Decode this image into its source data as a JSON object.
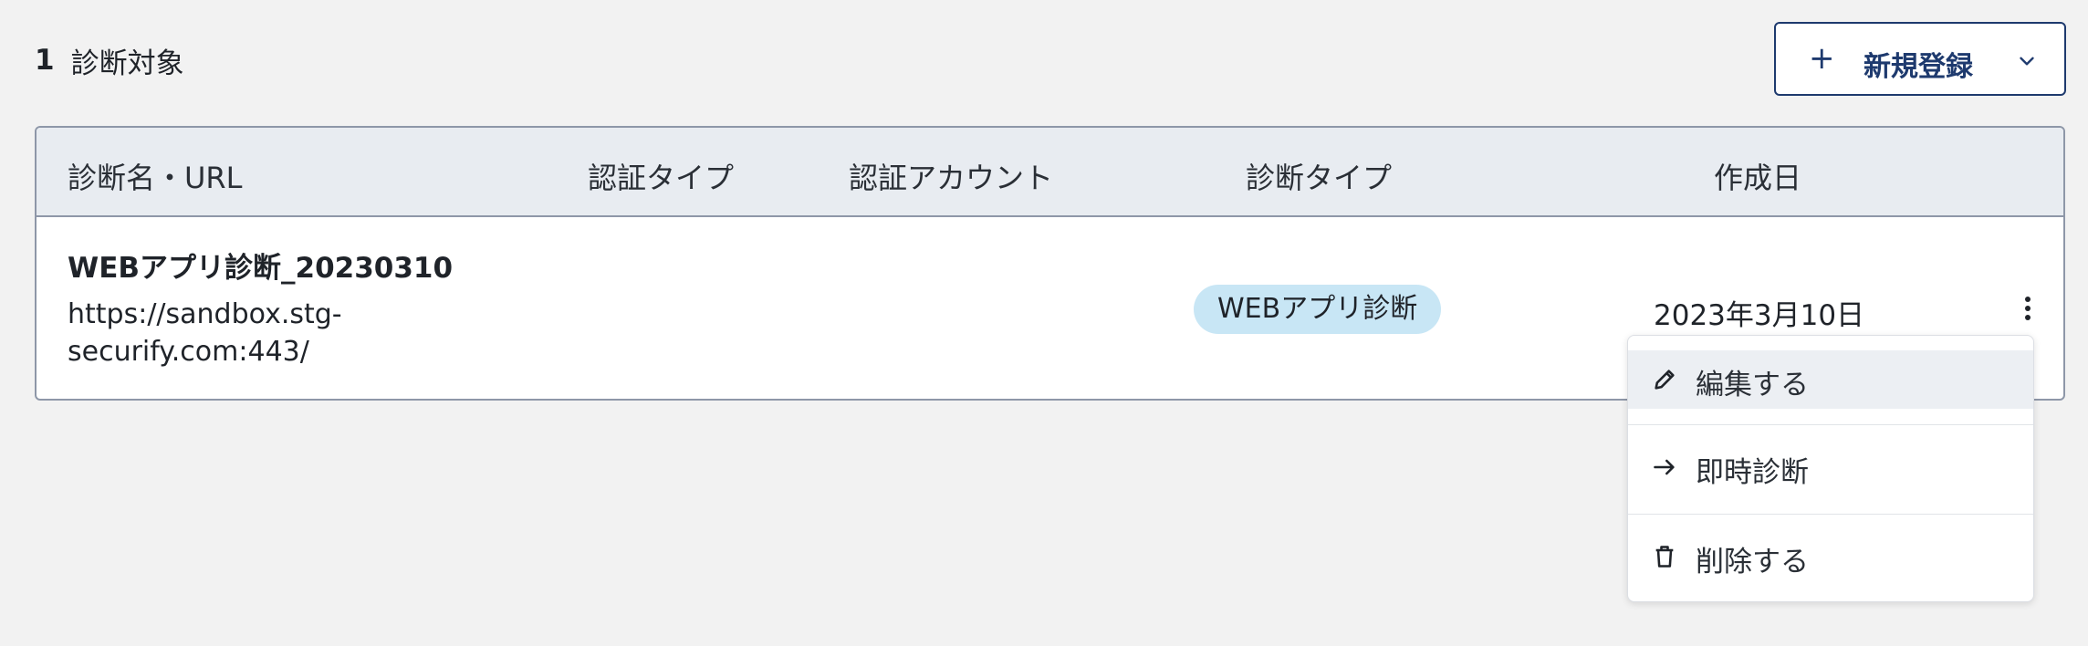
{
  "summary": {
    "count": "1",
    "label": "診断対象"
  },
  "new_button": {
    "plus": "+",
    "label": "新規登録",
    "chevron_icon": "chevron-down-icon"
  },
  "table": {
    "headers": [
      "診断名・URL",
      "認証タイプ",
      "認証アカウント",
      "診断タイプ",
      "作成日"
    ],
    "rows": [
      {
        "name": "WEBアプリ診断_20230310",
        "url": "https://sandbox.stg-securify.com:443/",
        "auth_type": "",
        "auth_account": "",
        "scan_type": "WEBアプリ診断",
        "created": "2023年3月10日"
      }
    ]
  },
  "context_menu": {
    "items": [
      {
        "label": "編集する",
        "icon": "pencil-icon"
      },
      {
        "label": "即時診断",
        "icon": "arrow-right-icon"
      },
      {
        "label": "削除する",
        "icon": "trash-icon"
      }
    ]
  },
  "colors": {
    "accent": "#1e3a6e",
    "badge_bg": "#c8e6f5",
    "header_bg": "#e8ecf1"
  }
}
